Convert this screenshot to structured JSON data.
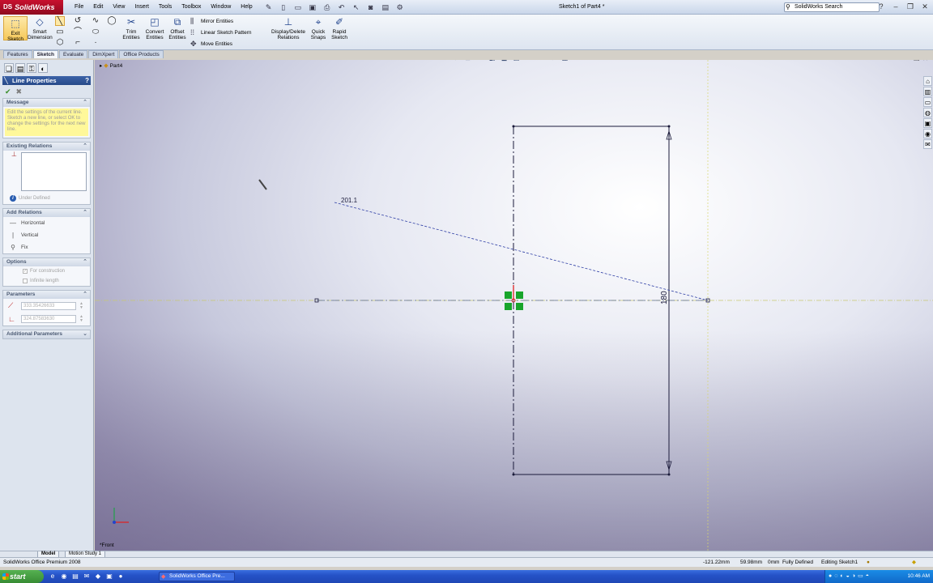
{
  "app": {
    "logo_prefix": "DS",
    "logo": "SolidWorks",
    "menu": [
      "File",
      "Edit",
      "View",
      "Insert",
      "Tools",
      "Toolbox",
      "Window",
      "Help"
    ],
    "document_title": "Sketch1 of Part4 *",
    "search_placeholder": "SolidWorks Search"
  },
  "commands": {
    "exit_sketch": "Exit Sketch",
    "smart_dimension": "Smart Dimension",
    "trim_entities": "Trim Entities",
    "convert_entities": "Convert Entities",
    "offset_entities": "Offset Entities",
    "mirror_entities": "Mirror Entities",
    "linear_sketch_pattern": "Linear Sketch Pattern",
    "move_entities": "Move Entities",
    "display_delete_relations": "Display/Delete Relations",
    "quick_snaps": "Quick Snaps",
    "rapid_sketch": "Rapid Sketch"
  },
  "command_tabs": [
    "Features",
    "Sketch",
    "Evaluate",
    "DimXpert",
    "Office Products"
  ],
  "property_manager": {
    "title": "Line Properties",
    "message_header": "Message",
    "message_text": "Edit the settings of the current line. Sketch a new line, or select OK to change the settings for the next new line.",
    "existing_relations_header": "Existing Relations",
    "under_defined": "Under Defined",
    "add_relations_header": "Add Relations",
    "relations": [
      "Horizontal",
      "Vertical",
      "Fix"
    ],
    "options_header": "Options",
    "options": [
      "For construction",
      "Infinite length"
    ],
    "parameters_header": "Parameters",
    "param_length": "333.35426633",
    "param_angle": "324.87583630",
    "additional_params_header": "Additional Parameters"
  },
  "viewport": {
    "part_label": "Part4",
    "view_label": "*Front",
    "dim_diagonal": "201.1",
    "dim_vertical": "180"
  },
  "bottom_tabs": [
    "Model",
    "Motion Study 1"
  ],
  "status": {
    "product": "SolidWorks Office Premium 2008",
    "x": "-121.22mm",
    "y": "59.98mm",
    "z": "0mm",
    "state": "Fully Defined",
    "editing": "Editing Sketch1"
  },
  "taskbar": {
    "start": "start",
    "task": "SolidWorks Office Pre...",
    "clock": "10:46 AM"
  },
  "colors": {
    "accent": "#274a89",
    "logo_red": "#c8102e",
    "sketch_line": "#1a1a3a",
    "dim_blue": "#2f3fa5",
    "fix_green": "#18a52b"
  }
}
